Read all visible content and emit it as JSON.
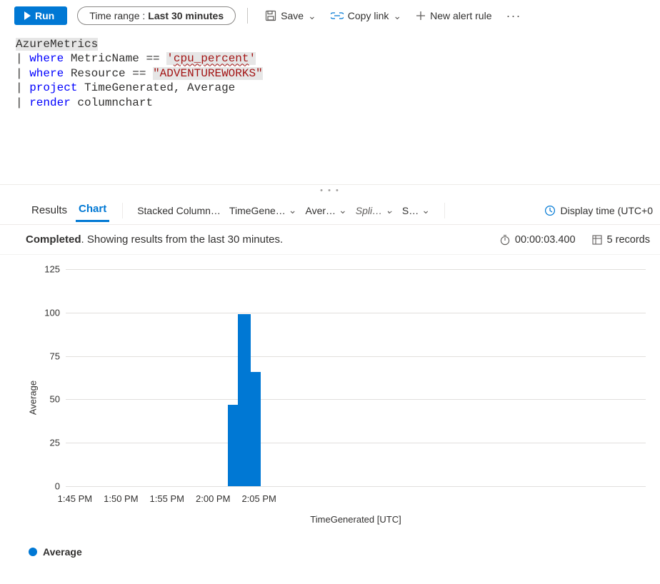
{
  "toolbar": {
    "run_label": "Run",
    "time_range_label": "Time range :",
    "time_range_value": "Last 30 minutes",
    "save_label": "Save",
    "copy_link_label": "Copy link",
    "new_alert_label": "New alert rule"
  },
  "query": {
    "table": "AzureMetrics",
    "line2_kw": "where",
    "line2_col": "MetricName",
    "line2_op": "==",
    "line2_val_q1": "'",
    "line2_val": "cpu_percent",
    "line2_val_q2": "'",
    "line3_kw": "where",
    "line3_col": "Resource",
    "line3_op": "==",
    "line3_val": "\"ADVENTUREWORKS\"",
    "line4_kw": "project",
    "line4_cols": "TimeGenerated, Average",
    "line5_kw": "render",
    "line5_arg": "columnchart"
  },
  "tabs": {
    "results": "Results",
    "chart": "Chart",
    "chart_type": "Stacked Column…",
    "x": "TimeGene…",
    "y": "Aver…",
    "split": "Spli…",
    "agg": "S…",
    "display_time": "Display time (UTC+0"
  },
  "status": {
    "completed": "Completed",
    "showing": ". Showing results from the last 30 minutes.",
    "duration": "00:00:03.400",
    "records": "5 records"
  },
  "legend": {
    "series": "Average"
  },
  "chart_data": {
    "type": "bar",
    "xlabel": "TimeGenerated [UTC]",
    "ylabel": "Average",
    "ylim": [
      0,
      125
    ],
    "yticks": [
      0,
      25,
      50,
      75,
      100,
      125
    ],
    "xticks": [
      "1:45 PM",
      "1:50 PM",
      "1:55 PM",
      "2:00 PM",
      "2:05 PM"
    ],
    "x_range_minutes": [
      42.5,
      107.5
    ],
    "series": [
      {
        "name": "Average",
        "color": "#0078d4",
        "points": [
          {
            "x_minute": 62.3,
            "label": "2:02 PM",
            "value": 47
          },
          {
            "x_minute": 63.4,
            "label": "2:03 PM",
            "value": 99
          },
          {
            "x_minute": 64.5,
            "label": "2:04 PM",
            "value": 66
          }
        ]
      }
    ]
  }
}
